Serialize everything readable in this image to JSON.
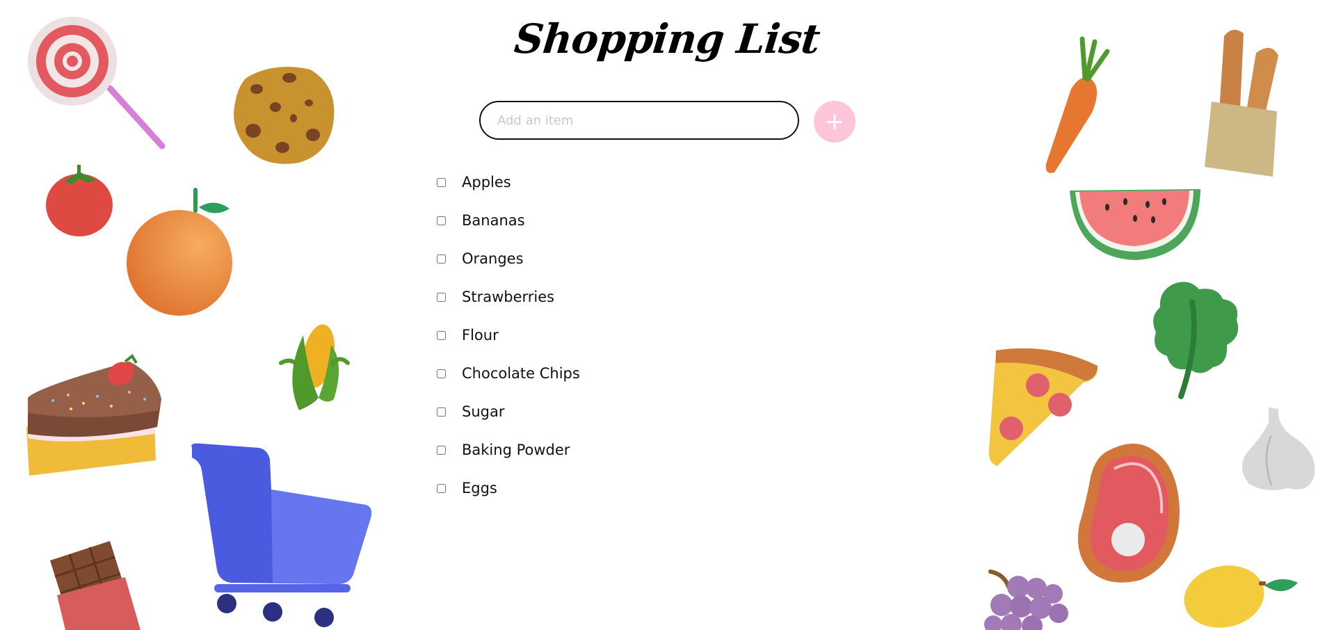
{
  "header": {
    "title": "Shopping List"
  },
  "add_item": {
    "placeholder": "Add an item",
    "value": "",
    "button_label": "+"
  },
  "items": [
    {
      "label": "Apples",
      "checked": false
    },
    {
      "label": "Bananas",
      "checked": false
    },
    {
      "label": "Oranges",
      "checked": false
    },
    {
      "label": "Strawberries",
      "checked": false
    },
    {
      "label": "Flour",
      "checked": false
    },
    {
      "label": "Chocolate Chips",
      "checked": false
    },
    {
      "label": "Sugar",
      "checked": false
    },
    {
      "label": "Baking Powder",
      "checked": false
    },
    {
      "label": "Eggs",
      "checked": false
    }
  ],
  "decorations": {
    "left": [
      "lollipop-icon",
      "cookie-icon",
      "tomato-icon",
      "orange-icon",
      "corn-icon",
      "cake-slice-icon",
      "shopping-cart-icon",
      "chocolate-bar-icon"
    ],
    "right": [
      "carrot-icon",
      "baguette-icon",
      "watermelon-slice-icon",
      "kale-icon",
      "pizza-slice-icon",
      "garlic-icon",
      "steak-icon",
      "grapes-icon",
      "lemon-icon"
    ]
  },
  "colors": {
    "accent_pink": "#ffc6da",
    "input_border": "#111111",
    "cart_blue": "#4b5be0"
  }
}
